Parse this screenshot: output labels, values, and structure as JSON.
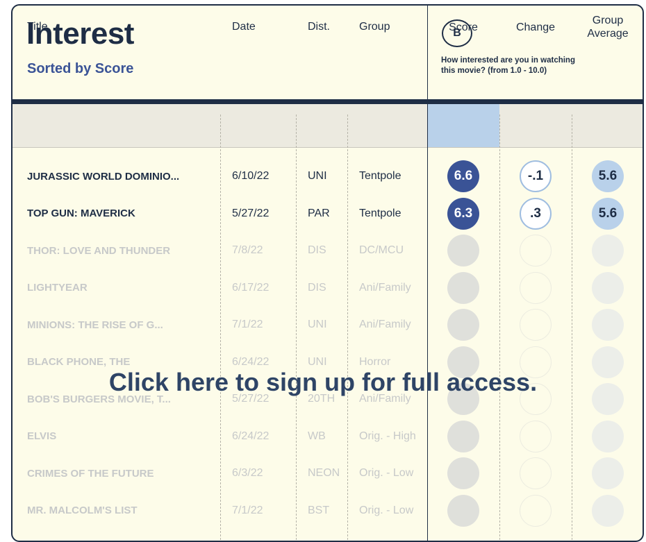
{
  "header": {
    "title": "Interest",
    "subtitle": "Sorted by Score",
    "badge": "B",
    "question": "How interested are you in watching this movie? (from 1.0 - 10.0)"
  },
  "columns": {
    "title": "Title",
    "date": "Date",
    "dist": "Dist.",
    "group": "Group",
    "score": "Score",
    "change": "Change",
    "group_average": "Group Average"
  },
  "rows": [
    {
      "title": "JURASSIC WORLD DOMINIO...",
      "date": "6/10/22",
      "dist": "UNI",
      "group": "Tentpole",
      "score": "6.6",
      "change": "-.1",
      "group_average": "5.6",
      "locked": false
    },
    {
      "title": "TOP GUN: MAVERICK",
      "date": "5/27/22",
      "dist": "PAR",
      "group": "Tentpole",
      "score": "6.3",
      "change": ".3",
      "group_average": "5.6",
      "locked": false
    },
    {
      "title": "THOR: LOVE AND THUNDER",
      "date": "7/8/22",
      "dist": "DIS",
      "group": "DC/MCU",
      "locked": true
    },
    {
      "title": "LIGHTYEAR",
      "date": "6/17/22",
      "dist": "DIS",
      "group": "Ani/Family",
      "locked": true
    },
    {
      "title": "MINIONS: THE RISE OF G...",
      "date": "7/1/22",
      "dist": "UNI",
      "group": "Ani/Family",
      "locked": true
    },
    {
      "title": "BLACK PHONE, THE",
      "date": "6/24/22",
      "dist": "UNI",
      "group": "Horror",
      "locked": true
    },
    {
      "title": "BOB'S BURGERS MOVIE, T...",
      "date": "5/27/22",
      "dist": "20TH",
      "group": "Ani/Family",
      "locked": true
    },
    {
      "title": "ELVIS",
      "date": "6/24/22",
      "dist": "WB",
      "group": "Orig. - High",
      "locked": true
    },
    {
      "title": "CRIMES OF THE FUTURE",
      "date": "6/3/22",
      "dist": "NEON",
      "group": "Orig. - Low",
      "locked": true
    },
    {
      "title": "MR. MALCOLM'S LIST",
      "date": "7/1/22",
      "dist": "BST",
      "group": "Orig. - Low",
      "locked": true
    }
  ],
  "cta": {
    "label": "Click here to sign up for full access."
  },
  "colors": {
    "navy": "#1e2d45",
    "accent_blue": "#3a5396",
    "light_blue": "#b9d1ea",
    "card_bg": "#fdfce9"
  }
}
